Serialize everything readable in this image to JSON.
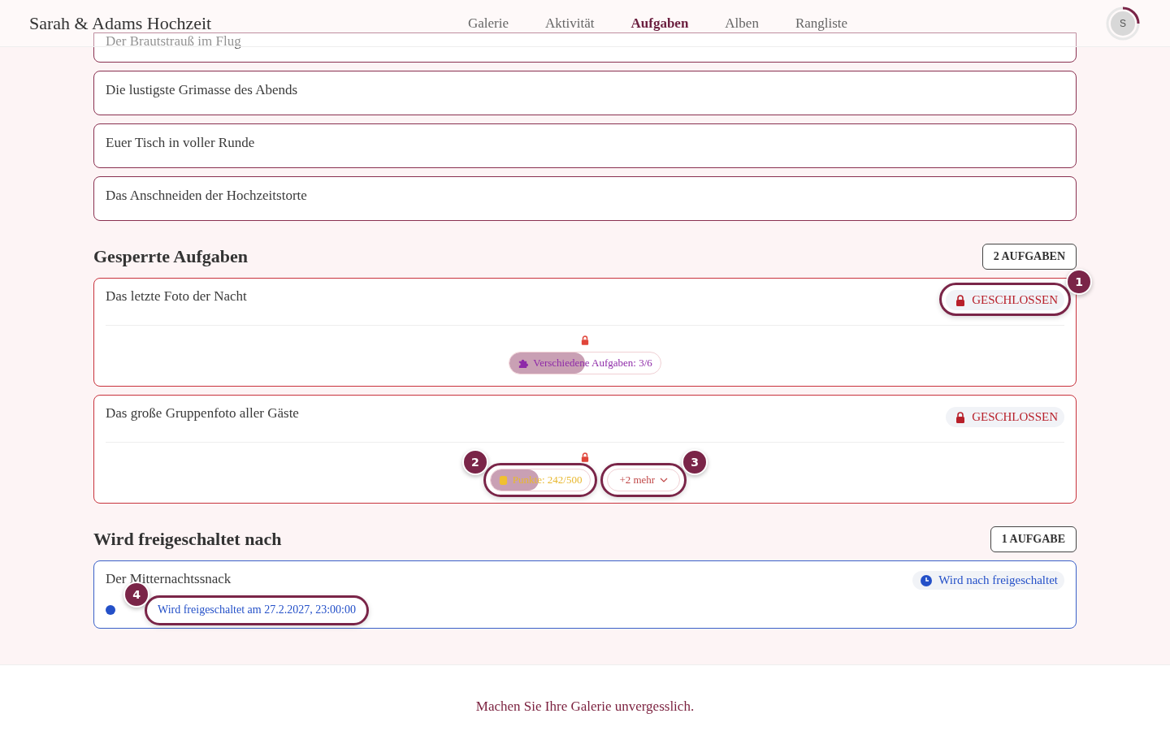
{
  "header": {
    "title": "Sarah & Adams Hochzeit",
    "nav": [
      {
        "label": "Galerie",
        "selected": false
      },
      {
        "label": "Aktivität",
        "selected": false
      },
      {
        "label": "Aufgaben",
        "selected": true
      },
      {
        "label": "Alben",
        "selected": false
      },
      {
        "label": "Rangliste",
        "selected": false
      }
    ],
    "avatar": {
      "initial": "S"
    }
  },
  "open_tasks": [
    {
      "title": "Der Brautstrauß im Flug"
    },
    {
      "title": "Die lustigste Grimasse des Abends"
    },
    {
      "title": "Euer Tisch in voller Runde"
    },
    {
      "title": "Das Anschneiden der Hochzeitstorte"
    }
  ],
  "locked_section": {
    "title": "Gesperrte Aufgaben",
    "count": "2 AUFGABEN",
    "tasks": [
      {
        "title": "Das letzte Foto der Nacht",
        "status": "GESCHLOSSEN",
        "status_marker": "1",
        "requirements": [
          {
            "kind": "puzzle",
            "label": "Verschiedene Aufgaben: 3/6",
            "level": 0.5
          }
        ]
      },
      {
        "title": "Das große Gruppenfoto aller Gäste",
        "status": "GESCHLOSSEN",
        "requirements": [
          {
            "kind": "coins",
            "label": "Punkte: 242/500",
            "level": 0.484,
            "marker": "2"
          }
        ],
        "more": {
          "label": "+2 mehr",
          "marker": "3"
        }
      }
    ]
  },
  "scheduled_section": {
    "title": "Wird freigeschaltet nach",
    "count": "1 AUFGABE",
    "tasks": [
      {
        "title": "Der Mitternachtssnack",
        "status": "Wird nach freigeschaltet",
        "unlock_text": "Wird freigeschaltet am 27.2.2027, 23:00:00",
        "unlock_marker": "4"
      }
    ]
  },
  "footer": {
    "tagline": "Machen Sie Ihre Galerie unvergesslich."
  }
}
